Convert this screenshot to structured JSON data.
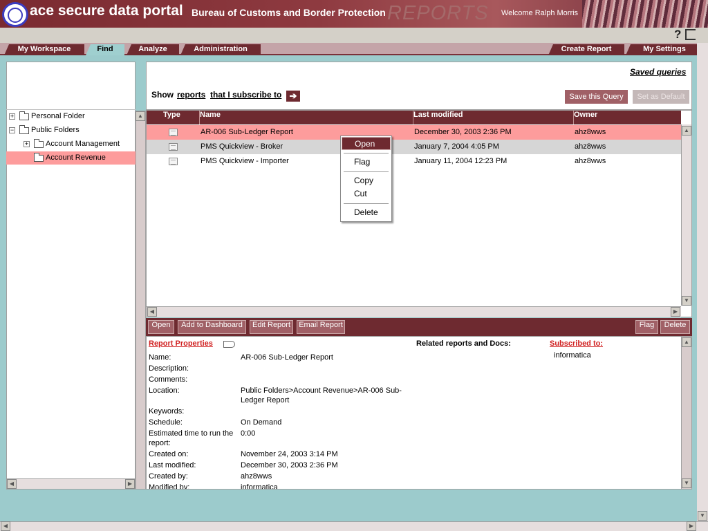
{
  "header": {
    "brand": "ace secure data portal",
    "bureau": "Bureau of Customs and Border Protection",
    "section": "REPORTS",
    "welcome": "Welcome Ralph Morris"
  },
  "tabs": {
    "left": [
      {
        "label": "My Workspace",
        "active": false
      },
      {
        "label": "Find",
        "active": true
      },
      {
        "label": "Analyze",
        "active": false
      },
      {
        "label": "Administration",
        "active": false
      }
    ],
    "right": [
      {
        "label": "Create Report"
      },
      {
        "label": "My Settings"
      }
    ]
  },
  "tree": {
    "items": [
      {
        "label": "Personal Folder",
        "expander": "+"
      },
      {
        "label": "Public Folders",
        "expander": "−"
      },
      {
        "label": "Account Management",
        "expander": "+"
      },
      {
        "label": "Account Revenue",
        "selected": true
      }
    ]
  },
  "query": {
    "saved_queries": "Saved queries",
    "show": "Show",
    "reports": "reports",
    "subscribe": "that I subscribe to",
    "save_query": "Save this Query",
    "set_default": "Set as Default"
  },
  "table": {
    "headers": [
      "Type",
      "Name",
      "Last modified",
      "Owner"
    ],
    "rows": [
      {
        "name": "AR-006 Sub-Ledger Report",
        "modified": "December 30, 2003 2:36 PM",
        "owner": "ahz8wws"
      },
      {
        "name": "PMS Quickview - Broker",
        "modified": "January 7, 2004 4:05 PM",
        "owner": "ahz8wws"
      },
      {
        "name": "PMS Quickview - Importer",
        "modified": "January 11, 2004 12:23 PM",
        "owner": "ahz8wws"
      }
    ]
  },
  "context_menu": {
    "items": [
      "Open",
      "Flag",
      "Copy",
      "Cut",
      "Delete"
    ]
  },
  "actions": {
    "open": "Open",
    "add_dashboard": "Add to Dashboard",
    "edit_report": "Edit Report",
    "email_report": "Email Report",
    "flag": "Flag",
    "delete": "Delete"
  },
  "properties": {
    "title": "Report Properties",
    "related_title": "Related reports and Docs:",
    "subscribed_title": "Subscribed to:",
    "subscribed_value": "informatica",
    "fields": [
      {
        "label": "Name:",
        "value": "AR-006 Sub-Ledger Report"
      },
      {
        "label": "Description:",
        "value": ""
      },
      {
        "label": "Comments:",
        "value": ""
      },
      {
        "label": "Location:",
        "value": "Public Folders>Account Revenue>AR-006 Sub-",
        "value2": "Ledger Report"
      },
      {
        "label": "Keywords:",
        "value": ""
      },
      {
        "label": "Schedule:",
        "value": "On Demand"
      },
      {
        "label": "Estimated time to run the",
        "label2": "report:",
        "value": "0:00"
      },
      {
        "label": "Created on:",
        "value": "November 24, 2003 3:14 PM"
      },
      {
        "label": "Last modified:",
        "value": "December 30, 2003 2:36 PM"
      },
      {
        "label": "Created by:",
        "value": "ahz8wws"
      },
      {
        "label": "Modified by:",
        "value": "informatica"
      }
    ]
  }
}
